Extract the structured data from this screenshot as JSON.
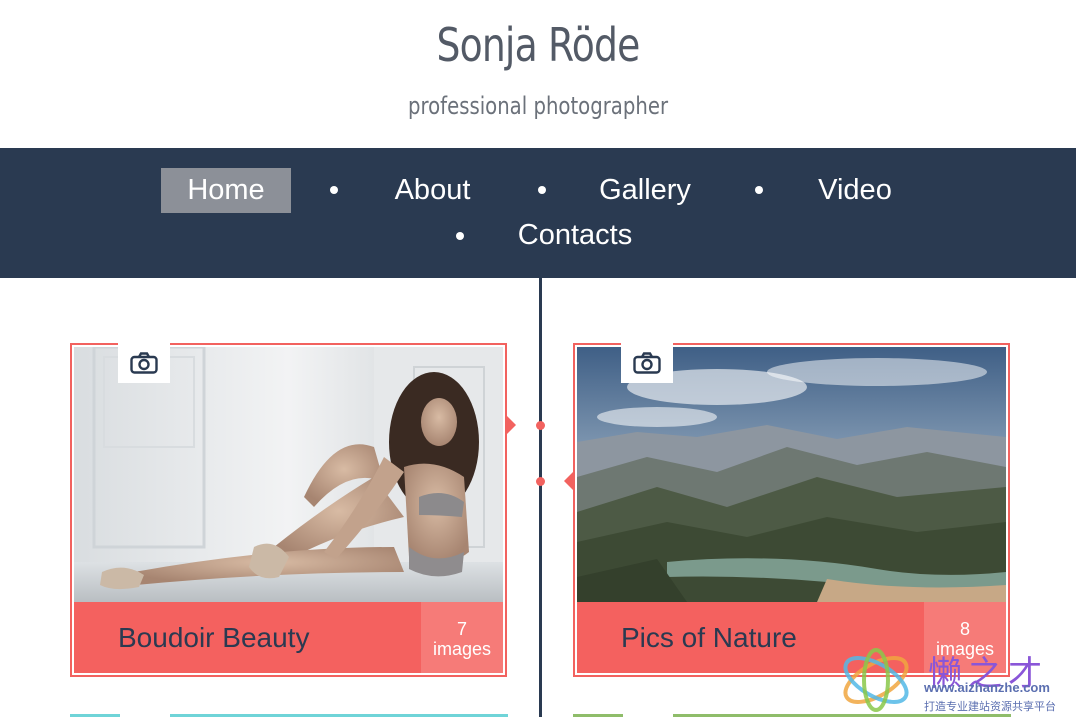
{
  "header": {
    "title": "Sonja Röde",
    "subtitle": "professional photographer"
  },
  "nav": {
    "items": [
      {
        "label": "Home",
        "active": true
      },
      {
        "label": "About"
      },
      {
        "label": "Gallery"
      },
      {
        "label": "Video"
      },
      {
        "label": "Contacts"
      }
    ]
  },
  "cards": [
    {
      "title": "Boudoir Beauty",
      "count": "7",
      "count_unit": "images",
      "icon": "camera-icon"
    },
    {
      "title": "Pics of Nature",
      "count": "8",
      "count_unit": "images",
      "icon": "camera-icon"
    }
  ],
  "watermark": {
    "brand": "懒之才",
    "url": "www.aizhanzhe.com",
    "tagline": "打造专业建站资源共享平台"
  },
  "colors": {
    "nav_bg": "#2a3a51",
    "accent": "#f2625f",
    "active_nav": "#8c9098",
    "teal": "#6fd4d8",
    "green": "#8fbd6a"
  }
}
